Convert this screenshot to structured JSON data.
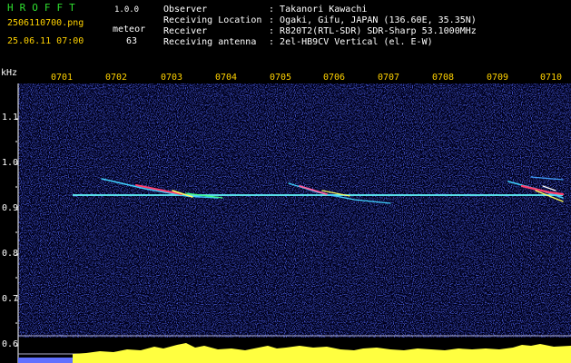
{
  "header": {
    "brand": "HROFFT",
    "version": "1.0.0",
    "filename": "2506110700.png",
    "datetime": "25.06.11 07:00",
    "meteor_label": "meteor",
    "meteor_count": "63"
  },
  "info": [
    {
      "label": "Observer",
      "value": "Takanori Kawachi"
    },
    {
      "label": "Receiving Location",
      "value": "Ogaki, Gifu, JAPAN (136.60E, 35.35N)"
    },
    {
      "label": "Receiver",
      "value": "R820T2(RTL-SDR) SDR-Sharp 53.1000MHz"
    },
    {
      "label": "Receiving antenna",
      "value": "2el-HB9CV Vertical (el. E-W)"
    }
  ],
  "axis": {
    "unit": "kHz",
    "y_ticks": [
      "1.1",
      "1.0",
      "0.9",
      "0.8",
      "0.7",
      "0.6"
    ],
    "x_ticks": [
      "0701",
      "0702",
      "0703",
      "0704",
      "0705",
      "0706",
      "0707",
      "0708",
      "0709",
      "0710"
    ]
  },
  "colors": {
    "background": "#00001a",
    "carrier": "#40d0ff",
    "power": "#ffff40"
  }
}
